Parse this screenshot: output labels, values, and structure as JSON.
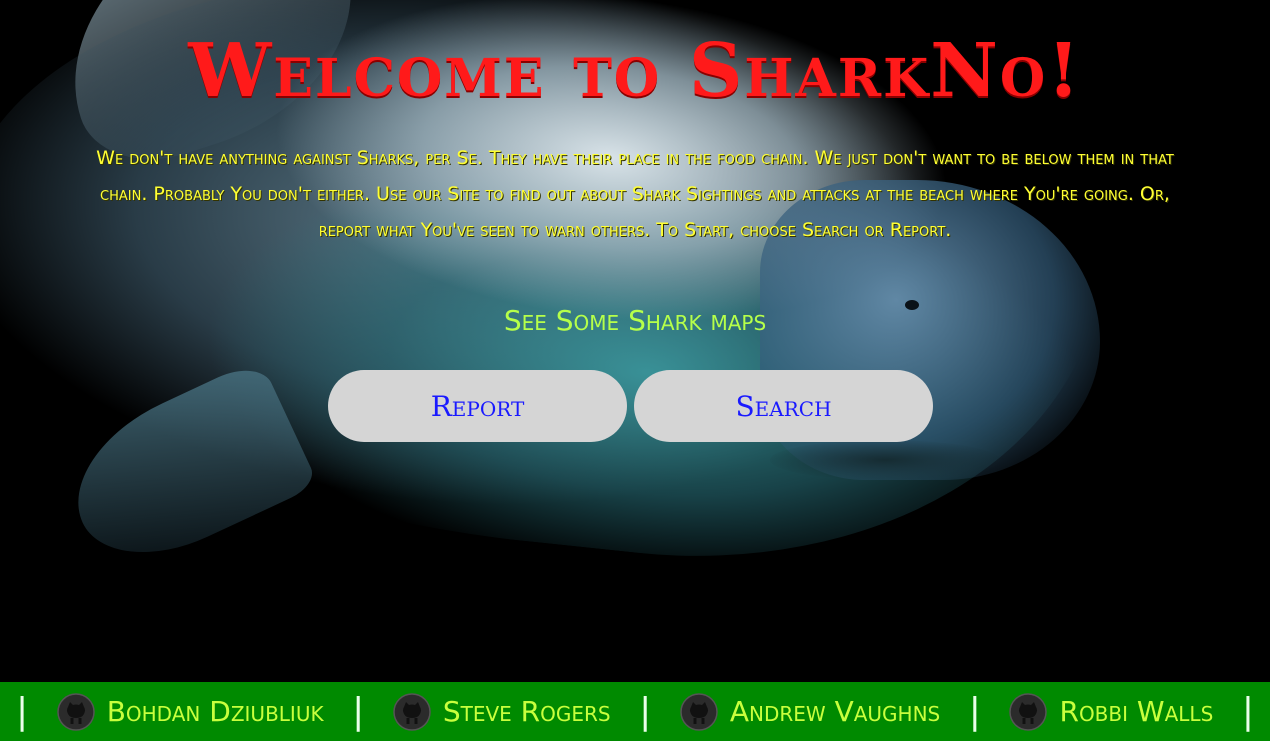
{
  "hero": {
    "title": "Welcome to SharkNo!",
    "intro": "We don't have anything against Sharks, per Se. They have their place in the food chain. We just don't want to be below them in that chain. Probably You don't either. Use our Site to find out about Shark Sightings and attacks at the beach where You're going. Or, report what You've seen to warn others. To Start, choose Search or Report.",
    "maps_link": "See Some Shark maps"
  },
  "buttons": {
    "report_label": "Report",
    "search_label": "Search"
  },
  "footer": {
    "separator": "|",
    "icon": "github-icon",
    "members": [
      {
        "name": "Bohdan Dziubliuk"
      },
      {
        "name": "Steve Rogers"
      },
      {
        "name": "Andrew Vaughns"
      },
      {
        "name": "Robbi Walls"
      }
    ]
  },
  "colors": {
    "title": "#ff1a1a",
    "intro": "#ffff33",
    "link": "#b6ff4a",
    "button_bg": "#d5d5d5",
    "button_text": "#1a1aff",
    "footer_bg": "#008a00",
    "footer_text": "#c8ff3d"
  }
}
